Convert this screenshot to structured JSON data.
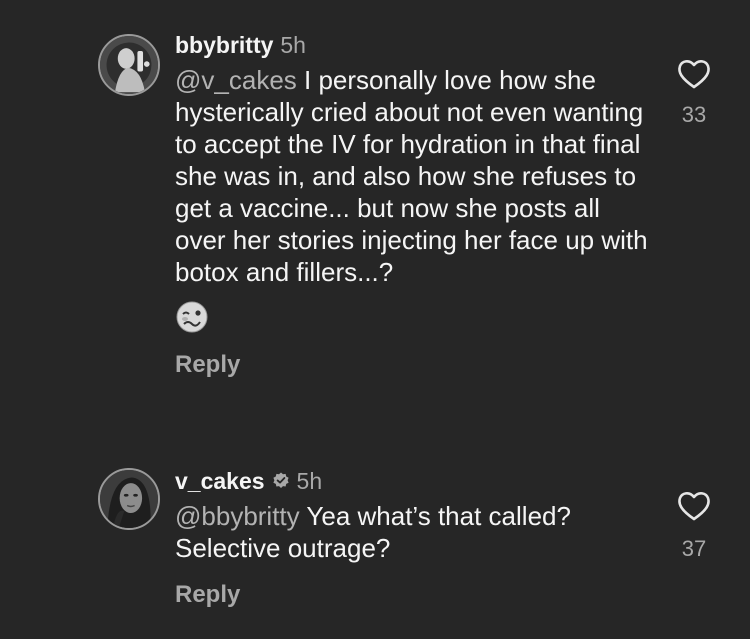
{
  "comments": [
    {
      "username": "bbybritty",
      "verified": false,
      "time": "5h",
      "mention": "@v_cakes",
      "text": " I personally love how she hysterically cried about not even wanting to accept the IV for hydration in that final she was in, and also how she refuses to get a vaccine... but now she posts all over her stories injecting her face up with botox and fillers...?",
      "emoji": "woozy-face",
      "reply_label": "Reply",
      "like_count": "33",
      "icons": {
        "like": "heart-outline-icon"
      }
    },
    {
      "username": "v_cakes",
      "verified": true,
      "time": "5h",
      "mention": "@bbybritty",
      "text": " Yea what’s that called? Selective outrage?",
      "reply_label": "Reply",
      "like_count": "37",
      "icons": {
        "like": "heart-outline-icon",
        "verified": "verified-badge-icon"
      }
    }
  ],
  "colors": {
    "background": "#262626",
    "text": "#f5f5f5",
    "secondary": "#a8a8a8",
    "mention": "#b3b3b3"
  }
}
